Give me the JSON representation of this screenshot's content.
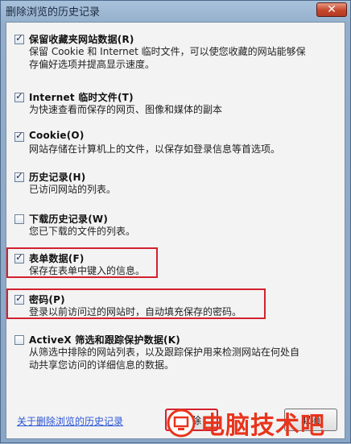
{
  "window": {
    "title": "删除浏览的历史记录",
    "close_label": "✕"
  },
  "options": [
    {
      "label": "保留收藏夹网站数据(R)",
      "desc": [
        "保留 Cookie 和 Internet 临时文件，可以使您收藏的网站能够保",
        "存偏好选项并提高显示速度。"
      ],
      "checked": true,
      "highlighted": false
    },
    {
      "label": "Internet 临时文件(T)",
      "desc": [
        "为快速查看而保存的网页、图像和媒体的副本"
      ],
      "checked": true,
      "highlighted": false
    },
    {
      "label": "Cookie(O)",
      "desc": [
        "网站存储在计算机上的文件，以保存如登录信息等首选项。"
      ],
      "checked": true,
      "highlighted": false
    },
    {
      "label": "历史记录(H)",
      "desc": [
        "已访问网站的列表。"
      ],
      "checked": true,
      "highlighted": false
    },
    {
      "label": "下载历史记录(W)",
      "desc": [
        "您已下载的文件的列表。"
      ],
      "checked": false,
      "highlighted": false
    },
    {
      "label": "表单数据(F)",
      "desc": [
        "保存在表单中键入的信息。"
      ],
      "checked": true,
      "highlighted": true
    },
    {
      "label": "密码(P)",
      "desc": [
        "登录以前访问过的网站时，自动填充保存的密码。"
      ],
      "checked": true,
      "highlighted": true
    },
    {
      "label": "ActiveX 筛选和跟踪保护数据(K)",
      "desc": [
        "从筛选中排除的网站列表，以及跟踪保护用来检测网站在何处自",
        "动共享您访问的详细信息的数据。"
      ],
      "checked": false,
      "highlighted": false
    }
  ],
  "footer": {
    "link_text": "关于删除浏览的历史记录",
    "delete_label": "删除",
    "cancel_label": "取消"
  },
  "watermark": {
    "text": "电脑技术吧",
    "color": "#e8341c"
  },
  "icons": [
    "close-icon",
    "check-icon",
    "watermark-logo-icon"
  ]
}
